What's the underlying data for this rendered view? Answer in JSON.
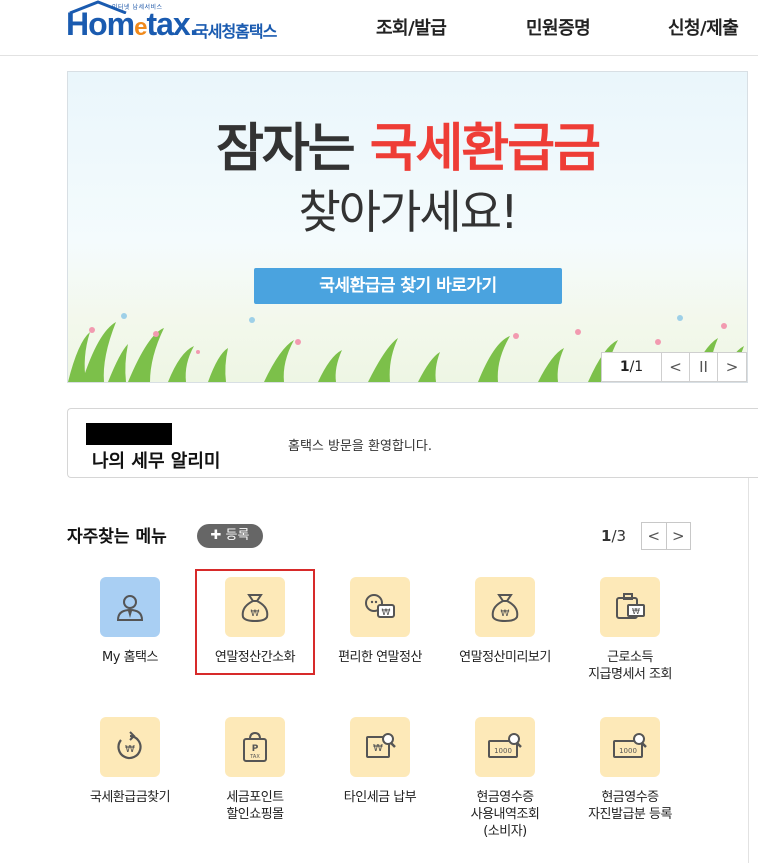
{
  "header": {
    "logo_tag": "인터넷 납세서비스",
    "logo_home": "Hom",
    "logo_e": "e",
    "logo_tax": "tax.",
    "logo_sub": "국세청홈택스",
    "nav": [
      "조회/발급",
      "민원증명",
      "신청/제출"
    ]
  },
  "banner": {
    "line1_plain": "잠자는 ",
    "line1_highlight": "국세환급금",
    "line2": "찾아가세요!",
    "cta": "국세환급금 찾기 바로가기",
    "pager_current": "1",
    "pager_total": "/1",
    "prev": "<",
    "pause": "II",
    "next": ">"
  },
  "alert": {
    "title": "나의 세무 알리미",
    "welcome": "홈택스 방문을 환영합니다."
  },
  "freq": {
    "title": "자주찾는 메뉴",
    "register": "✚ 등록",
    "page_current": "1",
    "page_total": "/3",
    "prev": "<",
    "next": ">",
    "items": [
      {
        "label": "My 홈택스",
        "label2": "",
        "icon": "user-icon"
      },
      {
        "label": "연말정산간소화",
        "label2": "",
        "icon": "money-bag-icon"
      },
      {
        "label": "편리한 연말정산",
        "label2": "",
        "icon": "coin-chat-icon"
      },
      {
        "label": "연말정산미리보기",
        "label2": "",
        "icon": "money-bag-icon"
      },
      {
        "label": "근로소득",
        "label2": "지급명세서 조회",
        "icon": "wallet-icon"
      },
      {
        "label": "국세환급금찾기",
        "label2": "",
        "icon": "refund-icon"
      },
      {
        "label": "세금포인트",
        "label2": "할인쇼핑몰",
        "icon": "shopping-bag-icon"
      },
      {
        "label": "타인세금 납부",
        "label2": "",
        "icon": "bill-search-icon"
      },
      {
        "label": "현금영수증",
        "label2": "사용내역조회",
        "label3": "(소비자)",
        "icon": "receipt-search-icon"
      },
      {
        "label": "현금영수증",
        "label2": "자진발급분 등록",
        "icon": "receipt-search-icon"
      }
    ]
  },
  "colors": {
    "brand_blue": "#1a5bb0",
    "highlight_red": "#ee3d36",
    "cta_blue": "#4aa3df",
    "icon_bg": "#fde9b8",
    "selected_border": "#d72a2a"
  }
}
